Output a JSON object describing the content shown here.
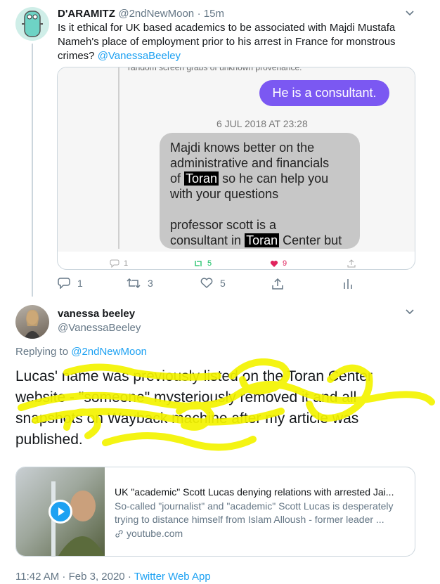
{
  "tweet1": {
    "display_name": "D'ARAMITZ",
    "handle": "@2ndNewMoon",
    "time": "· 15m",
    "text": "Is it ethical for UK based academics to be associated with Majdi Mustafa Nameh's place of employment prior to his arrest in France for monstrous crimes?",
    "mention": "@VanessaBeeley",
    "quoted": {
      "top_fragment": "random screen grabs of unknown provenance.",
      "purple_msg": "He is a consultant.",
      "date": "6 JUL 2018 AT 23:28",
      "gray_line1": "Majdi knows better on the",
      "gray_line2": "administrative and financials",
      "gray_line3_pre": "of",
      "gray_line3_hl": "Toran",
      "gray_line3_post": "so he can help you",
      "gray_line4": "with your questions",
      "gray_line5": "professor scott is a",
      "gray_line6_pre": "consultant in",
      "gray_line6_hl": "Toran",
      "gray_line6_post": "Center but",
      "replies": "1",
      "retweets": "5",
      "likes": "9"
    },
    "actions": {
      "replies": "1",
      "retweets": "3",
      "likes": "5"
    }
  },
  "tweet2": {
    "display_name": "vanessa beeley",
    "handle": "@VanessaBeeley",
    "replying_label": "Replying to",
    "replying_to": "@2ndNewMoon",
    "text": "Lucas' name was previously listed on the Toran Center website - \"someone\" mysteriously removed it and all snapshots on Wayback machine after my article was published.",
    "card": {
      "title": "UK \"academic\" Scott Lucas denying relations with arrested Jai...",
      "description": "So-called \"journalist\" and \"academic\" Scott Lucas is desperately trying to distance himself from Islam Alloush - former leader ...",
      "domain": "youtube.com"
    },
    "timestamp": "11:42 AM · Feb 3, 2020 ·",
    "client": "Twitter Web App"
  },
  "colors": {
    "accent": "#1da1f2",
    "highlighter": "#f2f200",
    "like": "#e0245e",
    "retweet": "#17bf63"
  },
  "icons": [
    "chevron-down-icon",
    "reply-icon",
    "retweet-icon",
    "heart-icon",
    "share-icon",
    "analytics-icon",
    "link-icon",
    "play-icon"
  ]
}
